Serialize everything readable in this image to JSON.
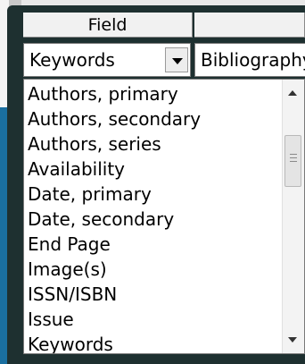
{
  "header": {
    "field_label": "Field",
    "second_label": ""
  },
  "field_combo": {
    "value": "Keywords",
    "dropdown_icon": "chevron-down-icon"
  },
  "second_combo": {
    "value": "Bibliography"
  },
  "field_list": {
    "items": [
      "Authors, primary",
      "Authors, secondary",
      "Authors, series",
      "Availability",
      "Date, primary",
      "Date, secondary",
      "End Page",
      "Image(s)",
      "ISSN/ISBN",
      "Issue",
      "Keywords"
    ]
  },
  "colors": {
    "frame": "#1e3030",
    "backdrop_blue": "#1a6fa0",
    "list_bg": "#ffffff"
  }
}
